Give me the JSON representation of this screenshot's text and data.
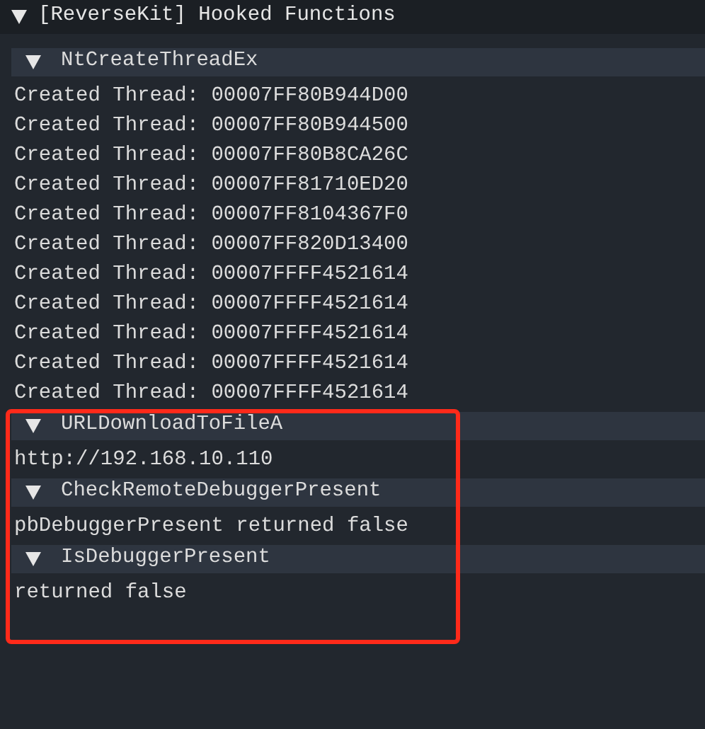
{
  "window": {
    "title": "[ReverseKit] Hooked Functions",
    "expanded": true
  },
  "sections": [
    {
      "name": "NtCreateThreadEx",
      "expanded": true,
      "highlighted": false,
      "lines": [
        "Created Thread: 00007FF80B944D00",
        "Created Thread: 00007FF80B944500",
        "Created Thread: 00007FF80B8CA26C",
        "Created Thread: 00007FF81710ED20",
        "Created Thread: 00007FF8104367F0",
        "Created Thread: 00007FF820D13400",
        "Created Thread: 00007FFFF4521614",
        "Created Thread: 00007FFFF4521614",
        "Created Thread: 00007FFFF4521614",
        "Created Thread: 00007FFFF4521614",
        "Created Thread: 00007FFFF4521614"
      ]
    },
    {
      "name": "URLDownloadToFileA",
      "expanded": true,
      "highlighted": true,
      "lines": [
        "http://192.168.10.110"
      ]
    },
    {
      "name": "CheckRemoteDebuggerPresent",
      "expanded": true,
      "highlighted": true,
      "lines": [
        "pbDebuggerPresent returned false"
      ]
    },
    {
      "name": "IsDebuggerPresent",
      "expanded": true,
      "highlighted": true,
      "lines": [
        "returned false"
      ]
    }
  ]
}
